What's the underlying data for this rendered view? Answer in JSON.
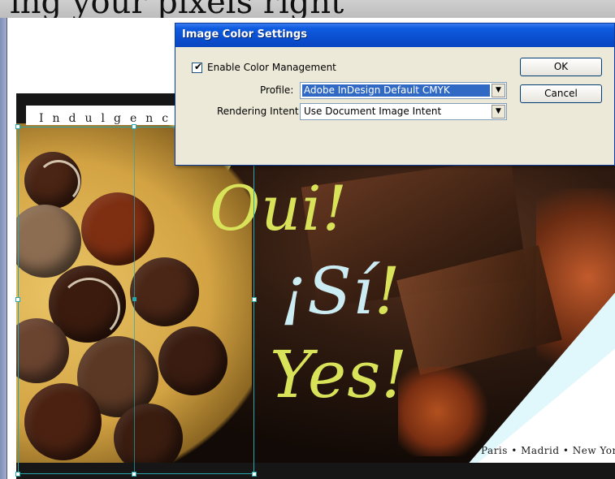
{
  "top_strip": {
    "text": "ing your pixels right"
  },
  "document": {
    "indulgence": "Indulgence",
    "headline_oui": "Oui!",
    "headline_si": "¡Sí",
    "headline_si_excl": "!",
    "headline_yes": "Yes!",
    "cities": "Paris • Madrid • New York"
  },
  "dialog": {
    "title": "Image Color Settings",
    "enable_color_management": {
      "label": "Enable Color Management",
      "checked": true
    },
    "profile": {
      "label": "Profile:",
      "value": "Adobe InDesign Default CMYK"
    },
    "rendering_intent": {
      "label": "Rendering Intent:",
      "value": "Use Document Image Intent"
    },
    "ok_label": "OK",
    "cancel_label": "Cancel"
  },
  "colors": {
    "title_bar": "#0a4fd0",
    "dialog_bg": "#ece9d8",
    "selection_frame": "#2aa7ad",
    "headline_lime": "#d9e35a",
    "headline_ice": "#ccecf4"
  },
  "icons": {
    "checkbox": "check-icon",
    "dropdown": "chevron-down-icon"
  }
}
